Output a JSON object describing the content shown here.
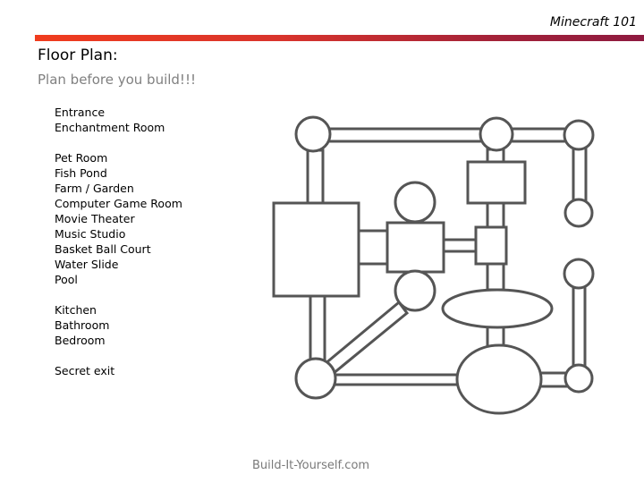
{
  "header": {
    "course_title": "Minecraft 101",
    "accent_colors": [
      "#f03c1e",
      "#8e1a40"
    ]
  },
  "slide": {
    "title": "Floor Plan:",
    "subtitle": "Plan before you build!!!"
  },
  "rooms": {
    "groups": [
      {
        "items": [
          "Entrance",
          "Enchantment Room"
        ]
      },
      {
        "items": [
          "Pet Room",
          "Fish Pond",
          "Farm / Garden",
          "Computer Game Room",
          "Movie Theater",
          "Music Studio",
          "Basket Ball Court",
          "Water Slide",
          "Pool"
        ]
      },
      {
        "items": [
          "Kitchen",
          "Bathroom",
          "Bedroom"
        ]
      },
      {
        "items": [
          "Secret exit"
        ]
      }
    ]
  },
  "diagram": {
    "description": "Floor plan of connected rooms (circles, rectangles, ellipses) joined by corridors",
    "line_color": "#555555"
  },
  "footer": {
    "text": "Build-It-Yourself.com"
  }
}
